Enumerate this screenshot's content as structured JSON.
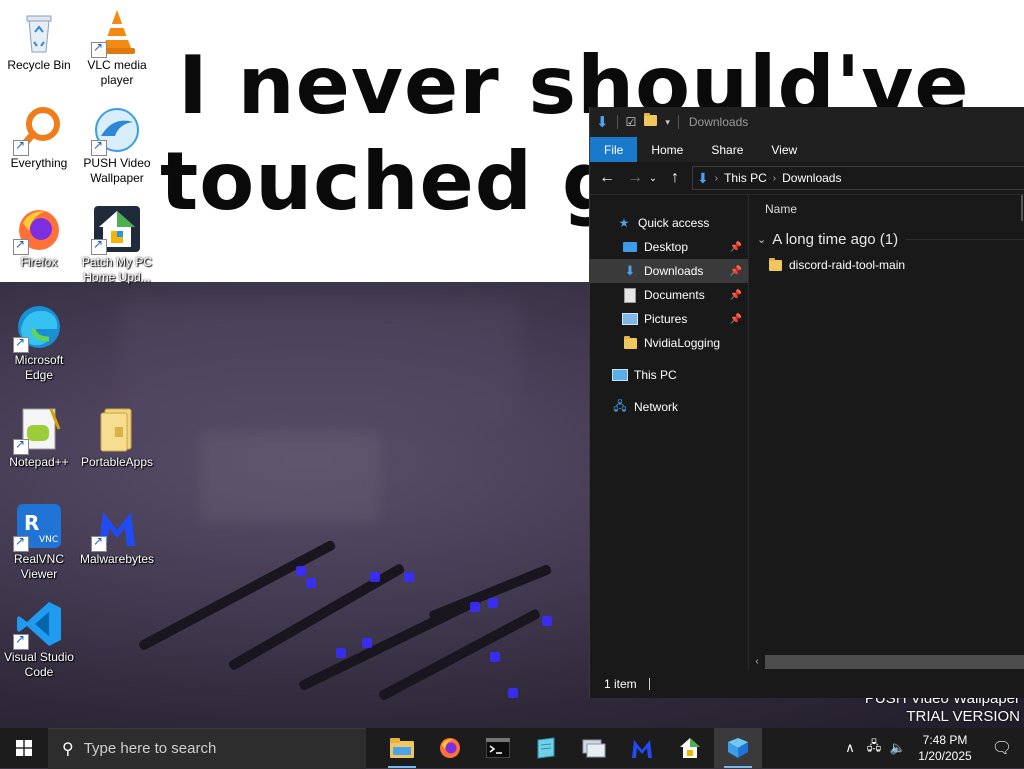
{
  "desktop": {
    "caption_line1": "I never should've",
    "caption_line2": "touched gr",
    "watermark_line1": "PUSH Video Wallpaper",
    "watermark_line2": "TRIAL VERSION",
    "icons": [
      {
        "label": "Recycle Bin",
        "icon": "recycle-bin-icon"
      },
      {
        "label": "VLC media player",
        "icon": "vlc-icon"
      },
      {
        "label": "Everything",
        "icon": "everything-search-icon"
      },
      {
        "label": "PUSH Video Wallpaper",
        "icon": "push-video-wallpaper-icon"
      },
      {
        "label": "Firefox",
        "icon": "firefox-icon"
      },
      {
        "label": "Patch My PC Home Upd...",
        "icon": "patch-my-pc-icon"
      },
      {
        "label": "Microsoft Edge",
        "icon": "edge-icon"
      },
      {
        "label": "Notepad++",
        "icon": "notepadpp-icon"
      },
      {
        "label": "PortableApps",
        "icon": "portableapps-folder-icon"
      },
      {
        "label": "RealVNC Viewer",
        "icon": "realvnc-icon"
      },
      {
        "label": "Malwarebytes",
        "icon": "malwarebytes-icon"
      },
      {
        "label": "Visual Studio Code",
        "icon": "vscode-icon"
      }
    ]
  },
  "explorer": {
    "title": "Downloads",
    "ribbon_tabs": [
      "File",
      "Home",
      "Share",
      "View"
    ],
    "breadcrumb": [
      "This PC",
      "Downloads"
    ],
    "nav": {
      "quick_access": "Quick access",
      "desktop": "Desktop",
      "downloads": "Downloads",
      "documents": "Documents",
      "pictures": "Pictures",
      "nvidia": "NvidiaLogging",
      "this_pc": "This PC",
      "network": "Network"
    },
    "column_name": "Name",
    "group_label": "A long time ago (1)",
    "files": [
      "discord-raid-tool-main"
    ],
    "status_count": "1 item"
  },
  "taskbar": {
    "search_placeholder": "Type here to search",
    "time": "7:48 PM",
    "date": "1/20/2025"
  },
  "colors": {
    "ribbon_file_tab": "#1979ca",
    "explorer_bg": "#191919",
    "taskbar_bg": "#1c1c1c",
    "folder_yellow": "#f0c75e"
  }
}
